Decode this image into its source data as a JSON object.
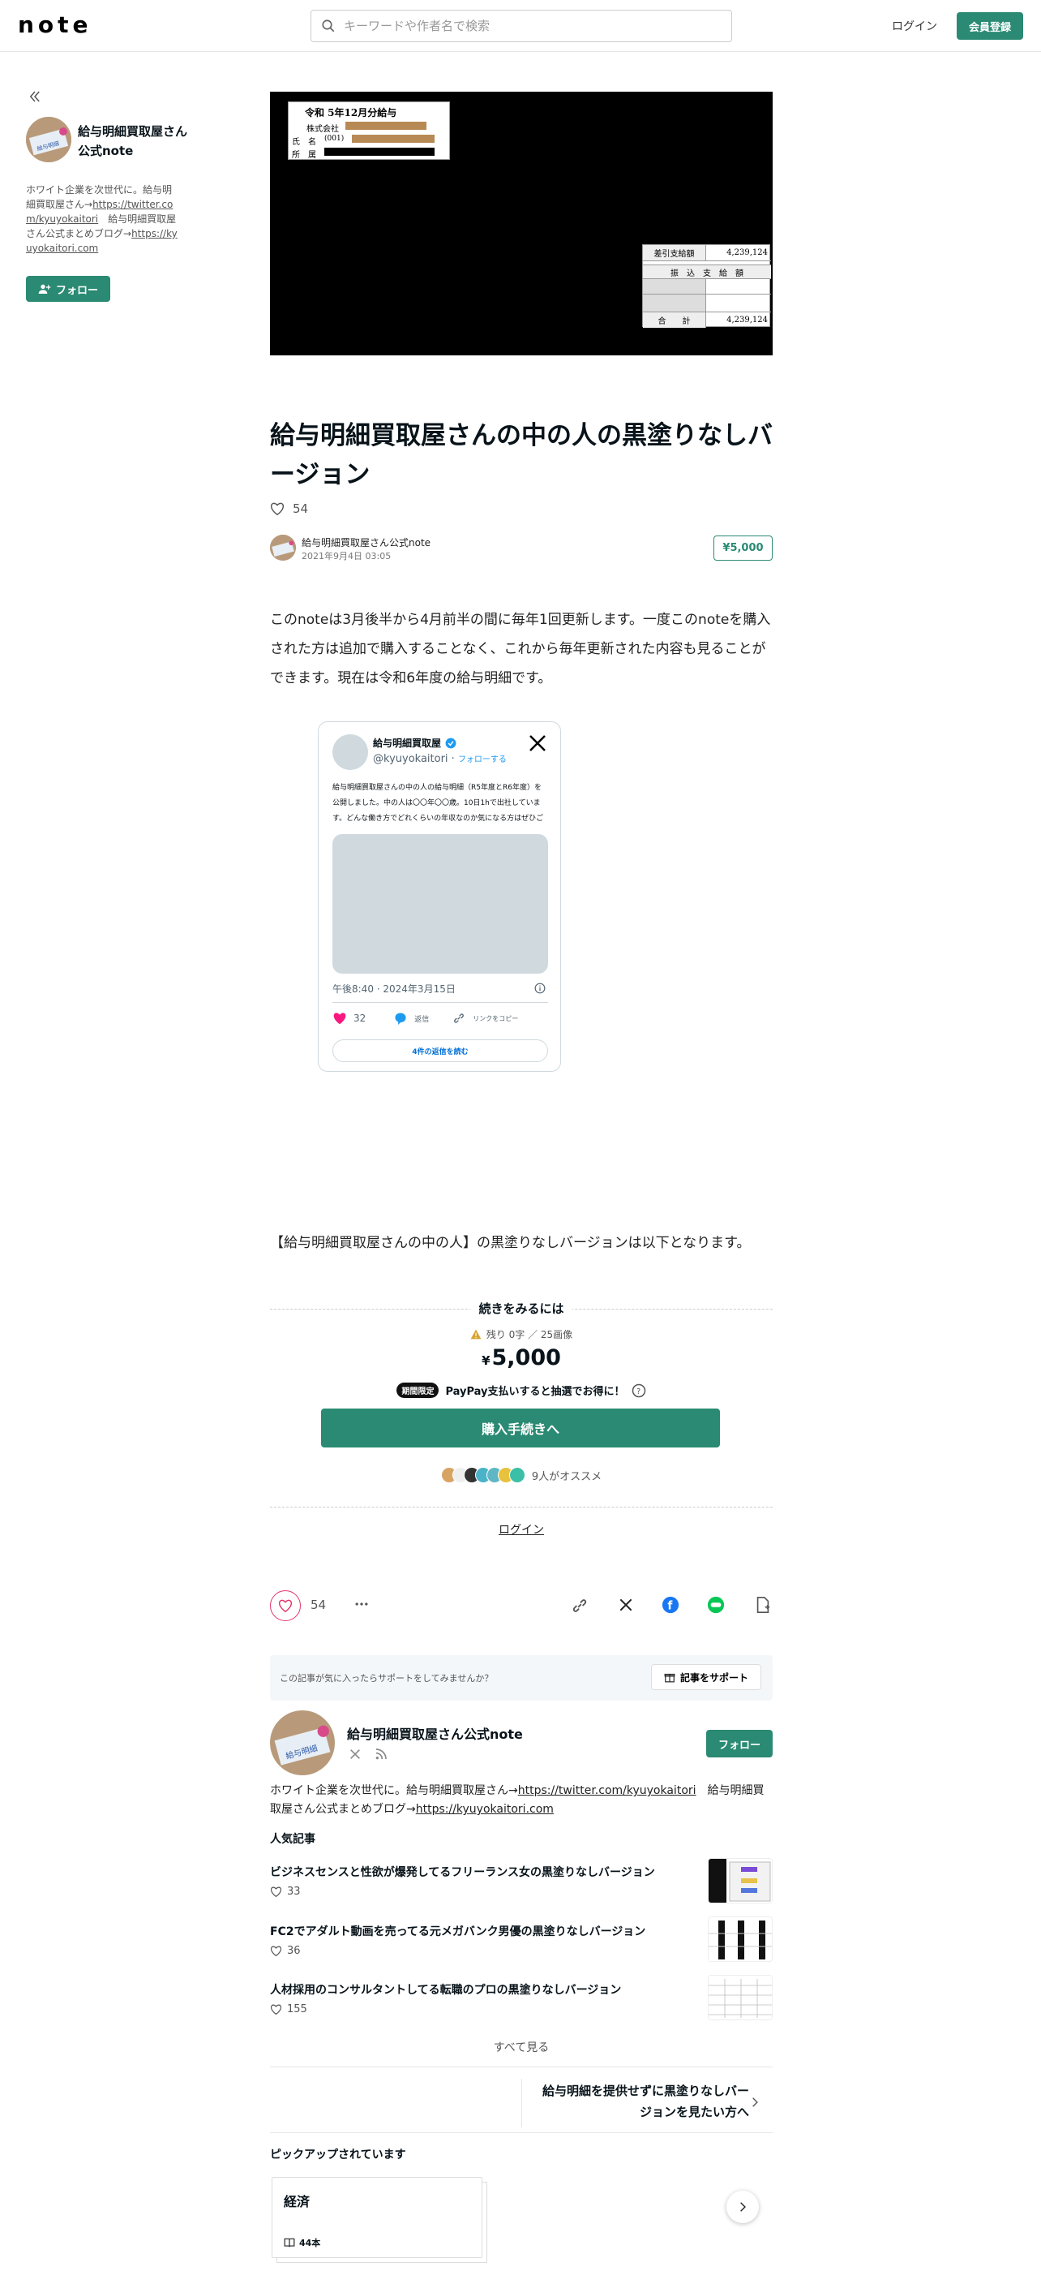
{
  "header": {
    "logo": "note",
    "search_placeholder": "キーワードや作者名で検索",
    "login": "ログイン",
    "signup": "会員登録"
  },
  "sidebar": {
    "creator_name": "給与明細買取屋さん公式note",
    "bio": "ホワイト企業を次世代に。給与明細買取屋さん→https://twitter.com/kyuyokaitori　給与明細買取屋さん公式まとめブログ→https://kyuyokaitori.com",
    "follow": "フォロー"
  },
  "hero": {
    "payslip_title": "令和 5年12月分給与",
    "company_label": "株式会社",
    "name_label": "氏　名",
    "name_code": "(001)",
    "dept_label": "所　属",
    "net_pay_label": "差引支給額",
    "net_pay_value": "4,239,124",
    "transfer_label": "振　込　支　給　額",
    "total_label": "合　　計",
    "total_value": "4,239,124"
  },
  "article": {
    "title": "給与明細買取屋さんの中の人の黒塗りなしバージョン",
    "likes": "54",
    "author": "給与明細買取屋さん公式note",
    "date": "2021年9月4日 03:05",
    "price_badge": "¥5,000",
    "intro": "このnoteは3月後半から4月前半の間に毎年1回更新します。一度このnoteを購入された方は追加で購入することなく、これから毎年更新された内容も見ることができます。現在は令和6年度の給与明細です。",
    "after_embed": "【給与明細買取屋さんの中の人】の黒塗りなしバージョンは以下となります。"
  },
  "tweet": {
    "display_name": "給与明細買取屋",
    "handle": "@kyuyokaitori",
    "follow": "フォローする",
    "body": "給与明細買取屋さんの中の人の給与明細（R5年度とR6年度）を公開しました。中の人は〇〇年〇〇歳。10日1hで出社しています。どんな働き方でどれくらいの年収なのか気になる方はぜひご覧ください。給与明細買取屋さんの中の人の黒塗りなしバージョン",
    "time": "午後8:40 · 2024年3月15日",
    "like_count": "32",
    "reply": "返信",
    "copy_link": "リンクをコピー",
    "read_replies": "4件の返信を読む"
  },
  "paywall": {
    "heading": "続きをみるには",
    "remaining": "残り 0字 ／ 25画像",
    "currency": "¥",
    "price": "5,000",
    "limited_badge": "期間限定",
    "paypay_text": "PayPay支払いすると抽選でお得に！",
    "purchase": "購入手続きへ",
    "recommend": "9人がオススメ",
    "login": "ログイン"
  },
  "actions": {
    "likes": "54"
  },
  "support": {
    "prompt": "この記事が気に入ったらサポートをしてみませんか？",
    "button": "記事をサポート"
  },
  "creator_card": {
    "name": "給与明細買取屋さん公式note",
    "follow": "フォロー",
    "bio_prefix": "ホワイト企業を次世代に。給与明細買取屋さん→",
    "twitter_url": "https://twitter.com/kyuyokaitori",
    "bio_middle": "　給与明細買取屋さん公式まとめブログ→",
    "blog_url": "https://kyuyokaitori.com"
  },
  "popular": {
    "heading": "人気記事",
    "items": [
      {
        "title": "ビジネスセンスと性欲が爆発してるフリーランス女の黒塗りなしバージョン",
        "likes": "33"
      },
      {
        "title": "FC2でアダルト動画を売ってる元メガバンク男優の黒塗りなしバージョン",
        "likes": "36"
      },
      {
        "title": "人材採用のコンサルタントしてる転職のプロの黒塗りなしバージョン",
        "likes": "155"
      }
    ],
    "see_all": "すべて見る"
  },
  "next_article": "給与明細を提供せずに黒塗りなしバージョンを見たい方へ",
  "pickup": {
    "heading": "ピックアップされています",
    "magazine": "経済",
    "count": "44本"
  },
  "colors": {
    "accent": "#2a8a73",
    "like_pink": "#e2376a"
  }
}
